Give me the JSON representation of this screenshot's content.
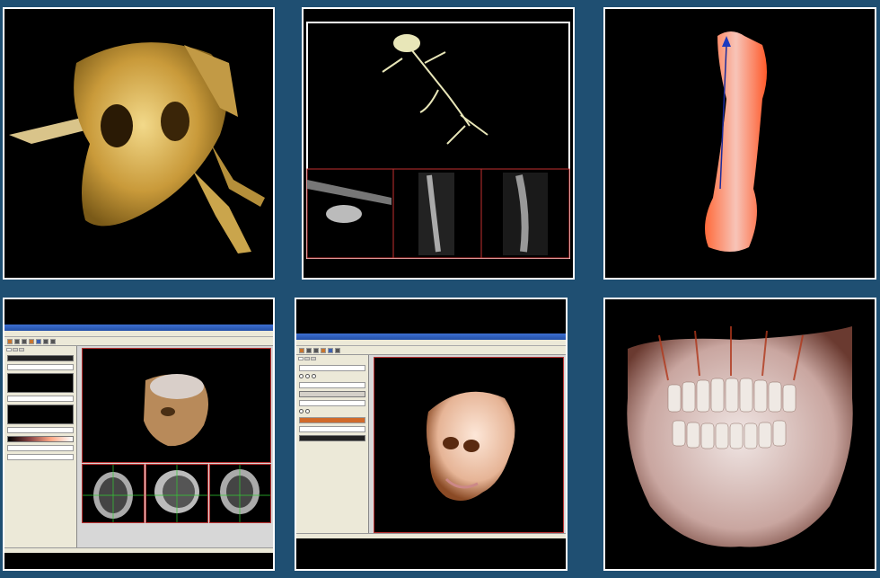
{
  "tiles": [
    {
      "id": "t1",
      "content": "skull-volume-render"
    },
    {
      "id": "t2",
      "content": "skeleton-mpr-view"
    },
    {
      "id": "t3",
      "content": "femur-render"
    },
    {
      "id": "t4",
      "content": "app-window-head-mpr"
    },
    {
      "id": "t5",
      "content": "app-window-head-render"
    },
    {
      "id": "t6",
      "content": "jaw-teeth-render"
    }
  ],
  "app4": {
    "menus": [
      "",
      "",
      "",
      "",
      "",
      "",
      ""
    ],
    "tabs": [
      "",
      "",
      ""
    ]
  },
  "app5": {
    "menus": [
      "",
      "",
      "",
      "",
      "",
      "",
      ""
    ],
    "tabs": [
      "",
      "",
      ""
    ]
  },
  "colors": {
    "background": "#1f4f72",
    "tile_border": "#ffffff",
    "bone": "#d8b45a",
    "femur": "#f07050"
  }
}
